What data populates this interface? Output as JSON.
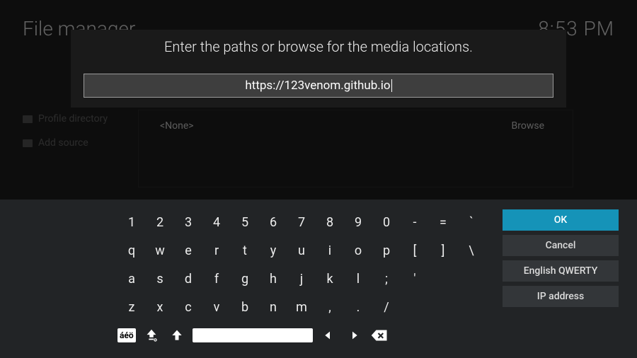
{
  "header": {
    "title": "File manager",
    "clock": "8:53 PM"
  },
  "background": {
    "sidebar": {
      "item1": "Profile directory",
      "item2": "Add source"
    },
    "panel": {
      "none_label": "<None>",
      "browse_label": "Browse"
    }
  },
  "dialog": {
    "prompt": "Enter the paths or browse for the media locations.",
    "input_value": "https://123venom.github.io"
  },
  "keyboard": {
    "row1": [
      "1",
      "2",
      "3",
      "4",
      "5",
      "6",
      "7",
      "8",
      "9",
      "0",
      "-",
      "=",
      "`"
    ],
    "row2": [
      "q",
      "w",
      "e",
      "r",
      "t",
      "y",
      "u",
      "i",
      "o",
      "p",
      "[",
      "]",
      "\\"
    ],
    "row3": [
      "a",
      "s",
      "d",
      "f",
      "g",
      "h",
      "j",
      "k",
      "l",
      ";",
      "'"
    ],
    "row4": [
      "z",
      "x",
      "c",
      "v",
      "b",
      "n",
      "m",
      ",",
      ".",
      "/"
    ],
    "accent_label": "áéö",
    "side": {
      "ok": "OK",
      "cancel": "Cancel",
      "layout": "English QWERTY",
      "ip": "IP address"
    }
  }
}
